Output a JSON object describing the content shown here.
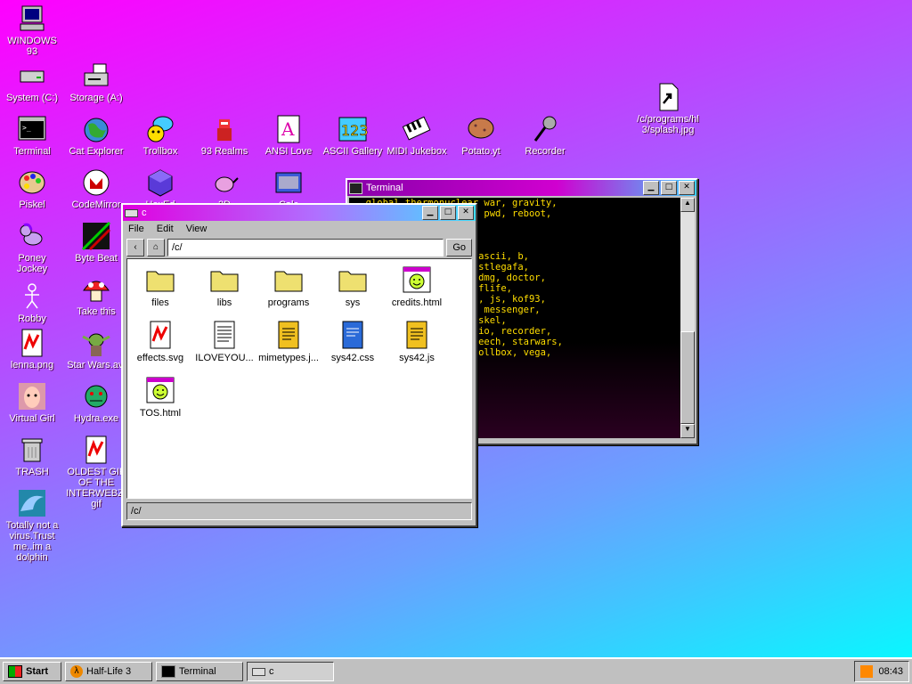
{
  "desktop": {
    "icons": [
      {
        "label": "WINDOWS 93",
        "icon": "computer-icon"
      },
      {
        "label": "System (C:)",
        "icon": "drive-icon"
      },
      {
        "label": "Storage (A:)",
        "icon": "floppy-drive-icon"
      },
      {
        "label": "Terminal",
        "icon": "terminal-icon"
      },
      {
        "label": "Cat Explorer",
        "icon": "globe-icon"
      },
      {
        "label": "Trollbox",
        "icon": "chat-icon"
      },
      {
        "label": "93 Realms",
        "icon": "knight-icon"
      },
      {
        "label": "ANSI Love",
        "icon": "ansi-icon"
      },
      {
        "label": "ASCII Gallery",
        "icon": "ascii-icon"
      },
      {
        "label": "MIDI Jukebox",
        "icon": "piano-icon"
      },
      {
        "label": "Potato.yt",
        "icon": "potato-icon"
      },
      {
        "label": "Recorder",
        "icon": "microphone-icon"
      },
      {
        "label": "Piskel",
        "icon": "palette-icon"
      },
      {
        "label": "CodeMirror",
        "icon": "codemirror-icon"
      },
      {
        "label": "HexEd",
        "icon": "cube-icon"
      },
      {
        "label": "3D",
        "icon": "teapot-icon"
      },
      {
        "label": "Calc",
        "icon": "calculator-icon"
      },
      {
        "label": "Poney Jockey",
        "icon": "pony-icon"
      },
      {
        "label": "Byte Beat",
        "icon": "bytebeat-icon"
      },
      {
        "label": "Robby",
        "icon": "stickman-icon"
      },
      {
        "label": "Take this",
        "icon": "mushroom-icon"
      },
      {
        "label": "lenna.png",
        "icon": "image-file-icon"
      },
      {
        "label": "Star Wars.avi",
        "icon": "yoda-icon"
      },
      {
        "label": "Virtual Girl",
        "icon": "face-icon"
      },
      {
        "label": "Hydra.exe",
        "icon": "hydra-icon"
      },
      {
        "label": "TRASH",
        "icon": "trash-icon"
      },
      {
        "label": "OLDEST GIF OF THE INTERWEBZ.gif",
        "icon": "image-file-icon"
      },
      {
        "label": "Totally not a virus.Trust me..im a dolphin",
        "icon": "dolphin-icon"
      },
      {
        "label": "/c/programs/hl3/splash.jpg",
        "icon": "shortcut-icon"
      }
    ]
  },
  "explorer": {
    "title": "c",
    "menu": [
      "File",
      "Edit",
      "View"
    ],
    "path": "/c/",
    "go_label": "Go",
    "status": "/c/",
    "files": [
      {
        "name": "files",
        "type": "folder"
      },
      {
        "name": "libs",
        "type": "folder"
      },
      {
        "name": "programs",
        "type": "folder"
      },
      {
        "name": "sys",
        "type": "folder"
      },
      {
        "name": "credits.html",
        "type": "html"
      },
      {
        "name": "effects.svg",
        "type": "image"
      },
      {
        "name": "ILOVEYOU...",
        "type": "text"
      },
      {
        "name": "mimetypes.j...",
        "type": "js"
      },
      {
        "name": "sys42.css",
        "type": "css"
      },
      {
        "name": "sys42.js",
        "type": "js"
      },
      {
        "name": "TOS.html",
        "type": "html"
      }
    ]
  },
  "terminal": {
    "title": "Terminal",
    "lines": [
      "  global thermonuclear war, gravity,",
      "nfo, key, killall, ls, pwd, reboot,",
      "  whois, win",
      "",
      "",
      ", anthology, arena93, ascii, b,",
      "ox, bytebeat, calc, castlegafa,",
      "ntact, crazy, defrag, dmg, doctor,",
      ". font, g80.m3u, gameoflife,",
      "ydra, ie6, iframe, img, js, kof93,",
      "ifesto, marburg, maze, messenger,",
      "pin, nes, pd, peng, piskel,",
      "co, progressquest, radio, recorder,",
      "ree, sms, solitude, speech, starwars,",
      "terminal, textarea, trollbox, vega,",
      "cif, wlc, zkype"
    ]
  },
  "taskbar": {
    "start": "Start",
    "tasks": [
      {
        "label": "Half-Life 3",
        "icon": "halflife-icon"
      },
      {
        "label": "Terminal",
        "icon": "terminal-icon"
      },
      {
        "label": "c",
        "icon": "drive-icon"
      }
    ],
    "clock": "08:43"
  },
  "colors": {
    "title_gradient_start": "#d000d0",
    "title_gradient_end": "#40d0ff",
    "terminal_text": "#ffdd00"
  }
}
